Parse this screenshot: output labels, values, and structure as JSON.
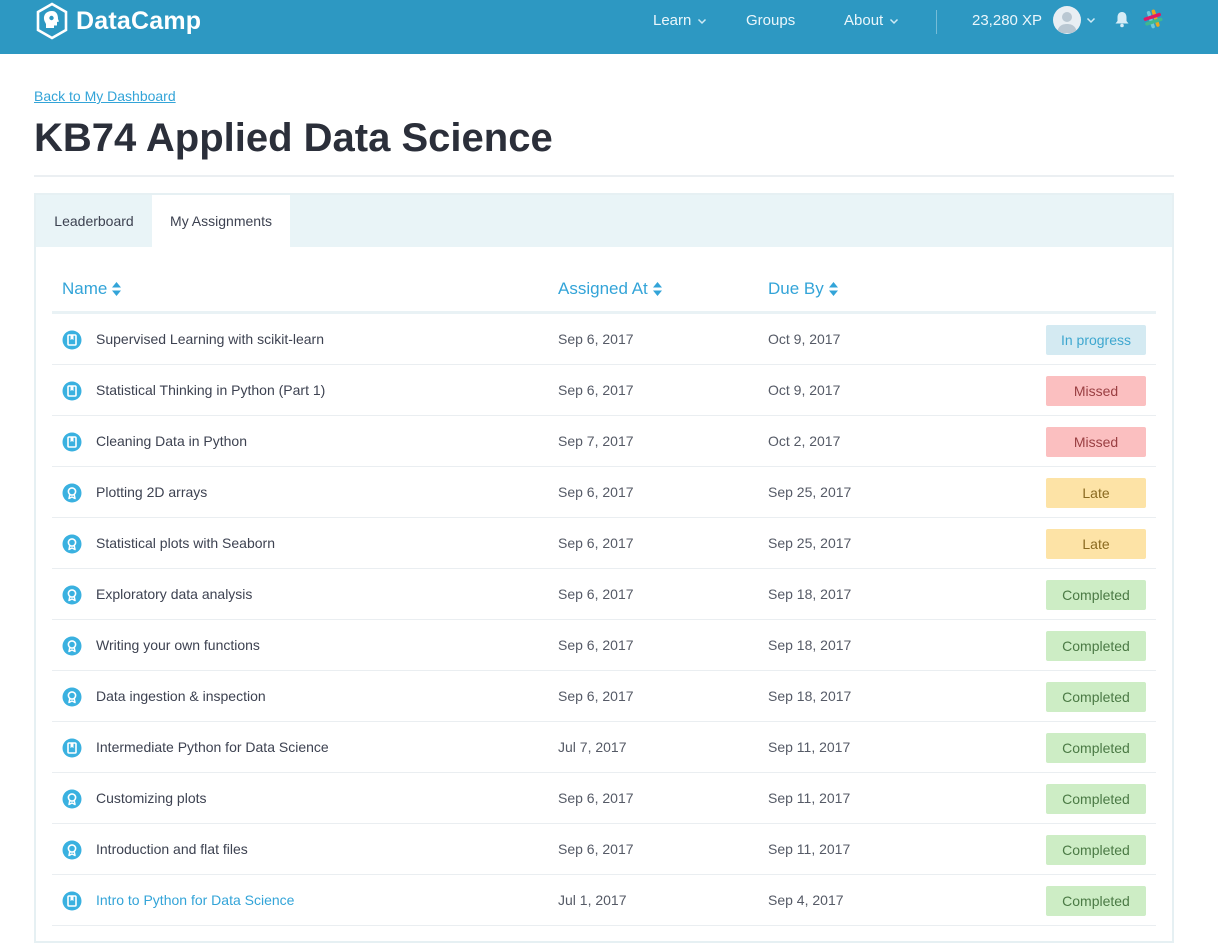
{
  "header": {
    "brand": "DataCamp",
    "nav": [
      {
        "label": "Learn",
        "has_dropdown": true
      },
      {
        "label": "Groups",
        "has_dropdown": false
      },
      {
        "label": "About",
        "has_dropdown": true
      }
    ],
    "xp": "23,280 XP",
    "icons": [
      "datacamp-logo-icon",
      "avatar-icon",
      "chevron-down-icon",
      "bell-icon",
      "slack-icon"
    ],
    "color": "#2d98c2"
  },
  "page": {
    "back_link": "Back to My Dashboard",
    "title": "KB74 Applied Data Science"
  },
  "tabs": [
    {
      "label": "Leaderboard",
      "active": false
    },
    {
      "label": "My Assignments",
      "active": true
    }
  ],
  "table": {
    "columns": {
      "name": "Name",
      "assigned": "Assigned At",
      "due": "Due By"
    },
    "rows": [
      {
        "type": "course",
        "name": "Supervised Learning with scikit-learn",
        "assigned": "Sep 6, 2017",
        "due": "Oct 9, 2017",
        "status": "In progress",
        "status_key": "progress"
      },
      {
        "type": "course",
        "name": "Statistical Thinking in Python (Part 1)",
        "assigned": "Sep 6, 2017",
        "due": "Oct 9, 2017",
        "status": "Missed",
        "status_key": "missed"
      },
      {
        "type": "course",
        "name": "Cleaning Data in Python",
        "assigned": "Sep 7, 2017",
        "due": "Oct 2, 2017",
        "status": "Missed",
        "status_key": "missed"
      },
      {
        "type": "chapter",
        "name": "Plotting 2D arrays",
        "assigned": "Sep 6, 2017",
        "due": "Sep 25, 2017",
        "status": "Late",
        "status_key": "late"
      },
      {
        "type": "chapter",
        "name": "Statistical plots with Seaborn",
        "assigned": "Sep 6, 2017",
        "due": "Sep 25, 2017",
        "status": "Late",
        "status_key": "late"
      },
      {
        "type": "chapter",
        "name": "Exploratory data analysis",
        "assigned": "Sep 6, 2017",
        "due": "Sep 18, 2017",
        "status": "Completed",
        "status_key": "completed"
      },
      {
        "type": "chapter",
        "name": "Writing your own functions",
        "assigned": "Sep 6, 2017",
        "due": "Sep 18, 2017",
        "status": "Completed",
        "status_key": "completed"
      },
      {
        "type": "chapter",
        "name": "Data ingestion & inspection",
        "assigned": "Sep 6, 2017",
        "due": "Sep 18, 2017",
        "status": "Completed",
        "status_key": "completed"
      },
      {
        "type": "course",
        "name": "Intermediate Python for Data Science",
        "assigned": "Jul 7, 2017",
        "due": "Sep 11, 2017",
        "status": "Completed",
        "status_key": "completed"
      },
      {
        "type": "chapter",
        "name": "Customizing plots",
        "assigned": "Sep 6, 2017",
        "due": "Sep 11, 2017",
        "status": "Completed",
        "status_key": "completed"
      },
      {
        "type": "chapter",
        "name": "Introduction and flat files",
        "assigned": "Sep 6, 2017",
        "due": "Sep 11, 2017",
        "status": "Completed",
        "status_key": "completed"
      },
      {
        "type": "course",
        "name": "Intro to Python for Data Science",
        "assigned": "Jul 1, 2017",
        "due": "Sep 4, 2017",
        "status": "Completed",
        "status_key": "completed",
        "highlighted": true
      }
    ]
  }
}
